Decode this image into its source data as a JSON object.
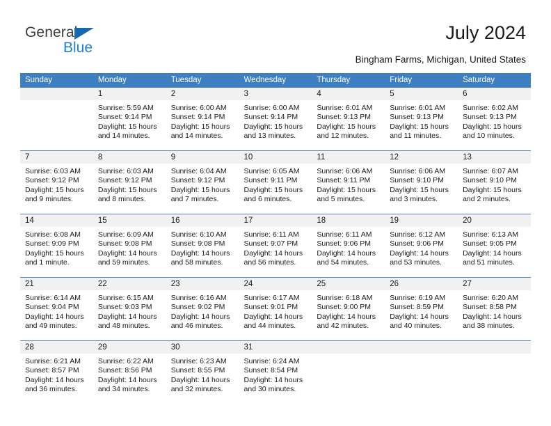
{
  "brand": {
    "name_part1": "General",
    "name_part2": "Blue",
    "triangle_icon": "triangle-icon",
    "accent_color": "#1b7fd4",
    "logo_dark_color": "#3c3c3c"
  },
  "header": {
    "title": "July 2024",
    "subtitle": "Bingham Farms, Michigan, United States"
  },
  "calendar": {
    "header_bg": "#3d7fc1",
    "daynum_bg": "#f1f1f1",
    "row_line_color": "#4a87c4",
    "weekdays": [
      "Sunday",
      "Monday",
      "Tuesday",
      "Wednesday",
      "Thursday",
      "Friday",
      "Saturday"
    ],
    "weeks": [
      [
        {
          "day": "",
          "sunrise": "",
          "sunset": "",
          "daylight_line1": "",
          "daylight_line2": "",
          "empty": true
        },
        {
          "day": "1",
          "sunrise": "Sunrise: 5:59 AM",
          "sunset": "Sunset: 9:14 PM",
          "daylight_line1": "Daylight: 15 hours",
          "daylight_line2": "and 14 minutes."
        },
        {
          "day": "2",
          "sunrise": "Sunrise: 6:00 AM",
          "sunset": "Sunset: 9:14 PM",
          "daylight_line1": "Daylight: 15 hours",
          "daylight_line2": "and 14 minutes."
        },
        {
          "day": "3",
          "sunrise": "Sunrise: 6:00 AM",
          "sunset": "Sunset: 9:14 PM",
          "daylight_line1": "Daylight: 15 hours",
          "daylight_line2": "and 13 minutes."
        },
        {
          "day": "4",
          "sunrise": "Sunrise: 6:01 AM",
          "sunset": "Sunset: 9:13 PM",
          "daylight_line1": "Daylight: 15 hours",
          "daylight_line2": "and 12 minutes."
        },
        {
          "day": "5",
          "sunrise": "Sunrise: 6:01 AM",
          "sunset": "Sunset: 9:13 PM",
          "daylight_line1": "Daylight: 15 hours",
          "daylight_line2": "and 11 minutes."
        },
        {
          "day": "6",
          "sunrise": "Sunrise: 6:02 AM",
          "sunset": "Sunset: 9:13 PM",
          "daylight_line1": "Daylight: 15 hours",
          "daylight_line2": "and 10 minutes."
        }
      ],
      [
        {
          "day": "7",
          "sunrise": "Sunrise: 6:03 AM",
          "sunset": "Sunset: 9:12 PM",
          "daylight_line1": "Daylight: 15 hours",
          "daylight_line2": "and 9 minutes."
        },
        {
          "day": "8",
          "sunrise": "Sunrise: 6:03 AM",
          "sunset": "Sunset: 9:12 PM",
          "daylight_line1": "Daylight: 15 hours",
          "daylight_line2": "and 8 minutes."
        },
        {
          "day": "9",
          "sunrise": "Sunrise: 6:04 AM",
          "sunset": "Sunset: 9:12 PM",
          "daylight_line1": "Daylight: 15 hours",
          "daylight_line2": "and 7 minutes."
        },
        {
          "day": "10",
          "sunrise": "Sunrise: 6:05 AM",
          "sunset": "Sunset: 9:11 PM",
          "daylight_line1": "Daylight: 15 hours",
          "daylight_line2": "and 6 minutes."
        },
        {
          "day": "11",
          "sunrise": "Sunrise: 6:06 AM",
          "sunset": "Sunset: 9:11 PM",
          "daylight_line1": "Daylight: 15 hours",
          "daylight_line2": "and 5 minutes."
        },
        {
          "day": "12",
          "sunrise": "Sunrise: 6:06 AM",
          "sunset": "Sunset: 9:10 PM",
          "daylight_line1": "Daylight: 15 hours",
          "daylight_line2": "and 3 minutes."
        },
        {
          "day": "13",
          "sunrise": "Sunrise: 6:07 AM",
          "sunset": "Sunset: 9:10 PM",
          "daylight_line1": "Daylight: 15 hours",
          "daylight_line2": "and 2 minutes."
        }
      ],
      [
        {
          "day": "14",
          "sunrise": "Sunrise: 6:08 AM",
          "sunset": "Sunset: 9:09 PM",
          "daylight_line1": "Daylight: 15 hours",
          "daylight_line2": "and 1 minute."
        },
        {
          "day": "15",
          "sunrise": "Sunrise: 6:09 AM",
          "sunset": "Sunset: 9:08 PM",
          "daylight_line1": "Daylight: 14 hours",
          "daylight_line2": "and 59 minutes."
        },
        {
          "day": "16",
          "sunrise": "Sunrise: 6:10 AM",
          "sunset": "Sunset: 9:08 PM",
          "daylight_line1": "Daylight: 14 hours",
          "daylight_line2": "and 58 minutes."
        },
        {
          "day": "17",
          "sunrise": "Sunrise: 6:11 AM",
          "sunset": "Sunset: 9:07 PM",
          "daylight_line1": "Daylight: 14 hours",
          "daylight_line2": "and 56 minutes."
        },
        {
          "day": "18",
          "sunrise": "Sunrise: 6:11 AM",
          "sunset": "Sunset: 9:06 PM",
          "daylight_line1": "Daylight: 14 hours",
          "daylight_line2": "and 54 minutes."
        },
        {
          "day": "19",
          "sunrise": "Sunrise: 6:12 AM",
          "sunset": "Sunset: 9:06 PM",
          "daylight_line1": "Daylight: 14 hours",
          "daylight_line2": "and 53 minutes."
        },
        {
          "day": "20",
          "sunrise": "Sunrise: 6:13 AM",
          "sunset": "Sunset: 9:05 PM",
          "daylight_line1": "Daylight: 14 hours",
          "daylight_line2": "and 51 minutes."
        }
      ],
      [
        {
          "day": "21",
          "sunrise": "Sunrise: 6:14 AM",
          "sunset": "Sunset: 9:04 PM",
          "daylight_line1": "Daylight: 14 hours",
          "daylight_line2": "and 49 minutes."
        },
        {
          "day": "22",
          "sunrise": "Sunrise: 6:15 AM",
          "sunset": "Sunset: 9:03 PM",
          "daylight_line1": "Daylight: 14 hours",
          "daylight_line2": "and 48 minutes."
        },
        {
          "day": "23",
          "sunrise": "Sunrise: 6:16 AM",
          "sunset": "Sunset: 9:02 PM",
          "daylight_line1": "Daylight: 14 hours",
          "daylight_line2": "and 46 minutes."
        },
        {
          "day": "24",
          "sunrise": "Sunrise: 6:17 AM",
          "sunset": "Sunset: 9:01 PM",
          "daylight_line1": "Daylight: 14 hours",
          "daylight_line2": "and 44 minutes."
        },
        {
          "day": "25",
          "sunrise": "Sunrise: 6:18 AM",
          "sunset": "Sunset: 9:00 PM",
          "daylight_line1": "Daylight: 14 hours",
          "daylight_line2": "and 42 minutes."
        },
        {
          "day": "26",
          "sunrise": "Sunrise: 6:19 AM",
          "sunset": "Sunset: 8:59 PM",
          "daylight_line1": "Daylight: 14 hours",
          "daylight_line2": "and 40 minutes."
        },
        {
          "day": "27",
          "sunrise": "Sunrise: 6:20 AM",
          "sunset": "Sunset: 8:58 PM",
          "daylight_line1": "Daylight: 14 hours",
          "daylight_line2": "and 38 minutes."
        }
      ],
      [
        {
          "day": "28",
          "sunrise": "Sunrise: 6:21 AM",
          "sunset": "Sunset: 8:57 PM",
          "daylight_line1": "Daylight: 14 hours",
          "daylight_line2": "and 36 minutes."
        },
        {
          "day": "29",
          "sunrise": "Sunrise: 6:22 AM",
          "sunset": "Sunset: 8:56 PM",
          "daylight_line1": "Daylight: 14 hours",
          "daylight_line2": "and 34 minutes."
        },
        {
          "day": "30",
          "sunrise": "Sunrise: 6:23 AM",
          "sunset": "Sunset: 8:55 PM",
          "daylight_line1": "Daylight: 14 hours",
          "daylight_line2": "and 32 minutes."
        },
        {
          "day": "31",
          "sunrise": "Sunrise: 6:24 AM",
          "sunset": "Sunset: 8:54 PM",
          "daylight_line1": "Daylight: 14 hours",
          "daylight_line2": "and 30 minutes."
        },
        {
          "day": "",
          "sunrise": "",
          "sunset": "",
          "daylight_line1": "",
          "daylight_line2": "",
          "empty": true
        },
        {
          "day": "",
          "sunrise": "",
          "sunset": "",
          "daylight_line1": "",
          "daylight_line2": "",
          "empty": true
        },
        {
          "day": "",
          "sunrise": "",
          "sunset": "",
          "daylight_line1": "",
          "daylight_line2": "",
          "empty": true
        }
      ]
    ]
  }
}
